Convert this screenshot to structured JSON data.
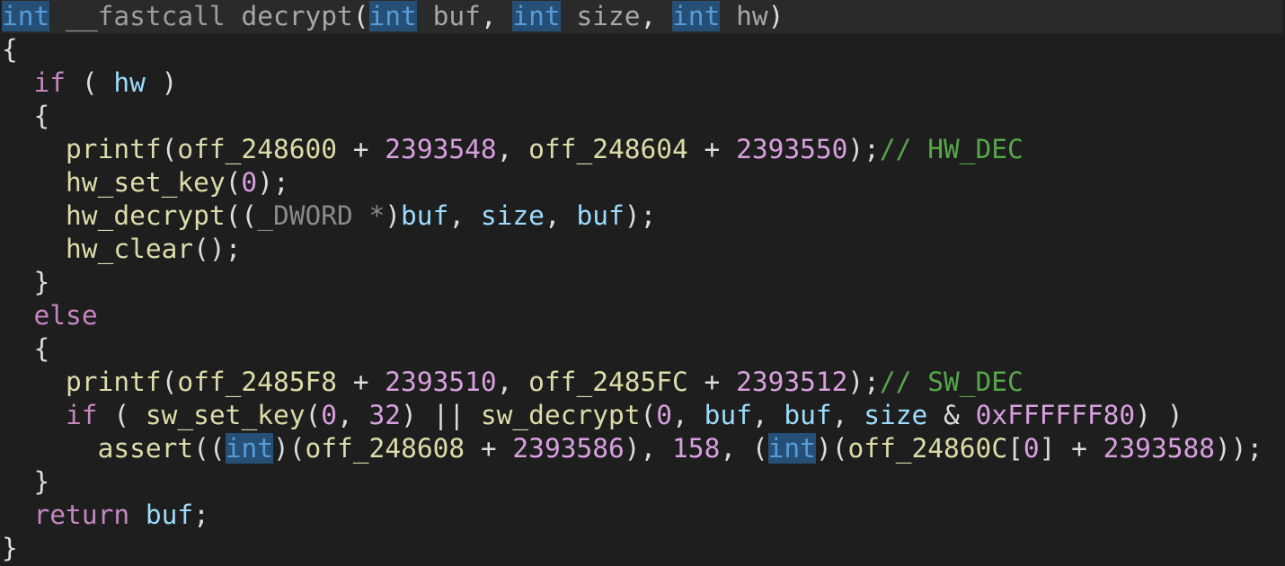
{
  "editor": {
    "lines": [
      [
        {
          "t": "int",
          "c": "kw-type"
        },
        {
          "t": " __fastcall ",
          "c": "kw-dim"
        },
        {
          "t": "decrypt",
          "c": "fn-dim"
        },
        {
          "t": "(",
          "c": "punct"
        },
        {
          "t": "int",
          "c": "kw-type"
        },
        {
          "t": " buf",
          "c": "fn-dim"
        },
        {
          "t": ", ",
          "c": "punct"
        },
        {
          "t": "int",
          "c": "kw-type"
        },
        {
          "t": " size",
          "c": "fn-dim"
        },
        {
          "t": ", ",
          "c": "punct"
        },
        {
          "t": "int",
          "c": "kw-type"
        },
        {
          "t": " hw",
          "c": "fn-dim"
        },
        {
          "t": ")",
          "c": "punct"
        }
      ],
      [
        {
          "t": "{",
          "c": "punct"
        }
      ],
      [
        {
          "t": "  ",
          "c": "plain"
        },
        {
          "t": "if",
          "c": "kw-ctrl"
        },
        {
          "t": " ( ",
          "c": "punct"
        },
        {
          "t": "hw",
          "c": "var"
        },
        {
          "t": " )",
          "c": "punct"
        }
      ],
      [
        {
          "t": "  {",
          "c": "punct"
        }
      ],
      [
        {
          "t": "    ",
          "c": "plain"
        },
        {
          "t": "printf",
          "c": "fn"
        },
        {
          "t": "(",
          "c": "punct"
        },
        {
          "t": "off_248600",
          "c": "fn"
        },
        {
          "t": " + ",
          "c": "punct"
        },
        {
          "t": "2393548",
          "c": "num"
        },
        {
          "t": ", ",
          "c": "punct"
        },
        {
          "t": "off_248604",
          "c": "fn"
        },
        {
          "t": " + ",
          "c": "punct"
        },
        {
          "t": "2393550",
          "c": "num"
        },
        {
          "t": ");",
          "c": "punct"
        },
        {
          "t": "// HW_DEC",
          "c": "comment"
        }
      ],
      [
        {
          "t": "    ",
          "c": "plain"
        },
        {
          "t": "hw_set_key",
          "c": "fn"
        },
        {
          "t": "(",
          "c": "punct"
        },
        {
          "t": "0",
          "c": "num"
        },
        {
          "t": ");",
          "c": "punct"
        }
      ],
      [
        {
          "t": "    ",
          "c": "plain"
        },
        {
          "t": "hw_decrypt",
          "c": "fn"
        },
        {
          "t": "((",
          "c": "punct"
        },
        {
          "t": "_DWORD *",
          "c": "macro"
        },
        {
          "t": ")",
          "c": "punct"
        },
        {
          "t": "buf",
          "c": "var"
        },
        {
          "t": ", ",
          "c": "punct"
        },
        {
          "t": "size",
          "c": "var"
        },
        {
          "t": ", ",
          "c": "punct"
        },
        {
          "t": "buf",
          "c": "var"
        },
        {
          "t": ");",
          "c": "punct"
        }
      ],
      [
        {
          "t": "    ",
          "c": "plain"
        },
        {
          "t": "hw_clear",
          "c": "fn"
        },
        {
          "t": "();",
          "c": "punct"
        }
      ],
      [
        {
          "t": "  }",
          "c": "punct"
        }
      ],
      [
        {
          "t": "  ",
          "c": "plain"
        },
        {
          "t": "else",
          "c": "kw-ctrl"
        }
      ],
      [
        {
          "t": "  {",
          "c": "punct"
        }
      ],
      [
        {
          "t": "    ",
          "c": "plain"
        },
        {
          "t": "printf",
          "c": "fn"
        },
        {
          "t": "(",
          "c": "punct"
        },
        {
          "t": "off_2485F8",
          "c": "fn"
        },
        {
          "t": " + ",
          "c": "punct"
        },
        {
          "t": "2393510",
          "c": "num"
        },
        {
          "t": ", ",
          "c": "punct"
        },
        {
          "t": "off_2485FC",
          "c": "fn"
        },
        {
          "t": " + ",
          "c": "punct"
        },
        {
          "t": "2393512",
          "c": "num"
        },
        {
          "t": ");",
          "c": "punct"
        },
        {
          "t": "// SW_DEC",
          "c": "comment"
        }
      ],
      [
        {
          "t": "    ",
          "c": "plain"
        },
        {
          "t": "if",
          "c": "kw-ctrl"
        },
        {
          "t": " ( ",
          "c": "punct"
        },
        {
          "t": "sw_set_key",
          "c": "fn"
        },
        {
          "t": "(",
          "c": "punct"
        },
        {
          "t": "0",
          "c": "num"
        },
        {
          "t": ", ",
          "c": "punct"
        },
        {
          "t": "32",
          "c": "num"
        },
        {
          "t": ") || ",
          "c": "punct"
        },
        {
          "t": "sw_decrypt",
          "c": "fn"
        },
        {
          "t": "(",
          "c": "punct"
        },
        {
          "t": "0",
          "c": "num"
        },
        {
          "t": ", ",
          "c": "punct"
        },
        {
          "t": "buf",
          "c": "var"
        },
        {
          "t": ", ",
          "c": "punct"
        },
        {
          "t": "buf",
          "c": "var"
        },
        {
          "t": ", ",
          "c": "punct"
        },
        {
          "t": "size",
          "c": "var"
        },
        {
          "t": " & ",
          "c": "punct"
        },
        {
          "t": "0xFFFFFF80",
          "c": "num"
        },
        {
          "t": ") )",
          "c": "punct"
        }
      ],
      [
        {
          "t": "      ",
          "c": "plain"
        },
        {
          "t": "assert",
          "c": "fn"
        },
        {
          "t": "((",
          "c": "punct"
        },
        {
          "t": "int",
          "c": "kw-type"
        },
        {
          "t": ")(",
          "c": "punct"
        },
        {
          "t": "off_248608",
          "c": "fn"
        },
        {
          "t": " + ",
          "c": "punct"
        },
        {
          "t": "2393586",
          "c": "num"
        },
        {
          "t": "), ",
          "c": "punct"
        },
        {
          "t": "158",
          "c": "num"
        },
        {
          "t": ", (",
          "c": "punct"
        },
        {
          "t": "int",
          "c": "kw-type"
        },
        {
          "t": ")(",
          "c": "punct"
        },
        {
          "t": "off_24860C",
          "c": "fn"
        },
        {
          "t": "[",
          "c": "punct"
        },
        {
          "t": "0",
          "c": "num"
        },
        {
          "t": "] + ",
          "c": "punct"
        },
        {
          "t": "2393588",
          "c": "num"
        },
        {
          "t": "));",
          "c": "punct"
        }
      ],
      [
        {
          "t": "  }",
          "c": "punct"
        }
      ],
      [
        {
          "t": "  ",
          "c": "plain"
        },
        {
          "t": "return",
          "c": "kw-ctrl"
        },
        {
          "t": " ",
          "c": "plain"
        },
        {
          "t": "buf",
          "c": "var"
        },
        {
          "t": ";",
          "c": "punct"
        }
      ],
      [
        {
          "t": "}",
          "c": "punct"
        }
      ]
    ]
  }
}
